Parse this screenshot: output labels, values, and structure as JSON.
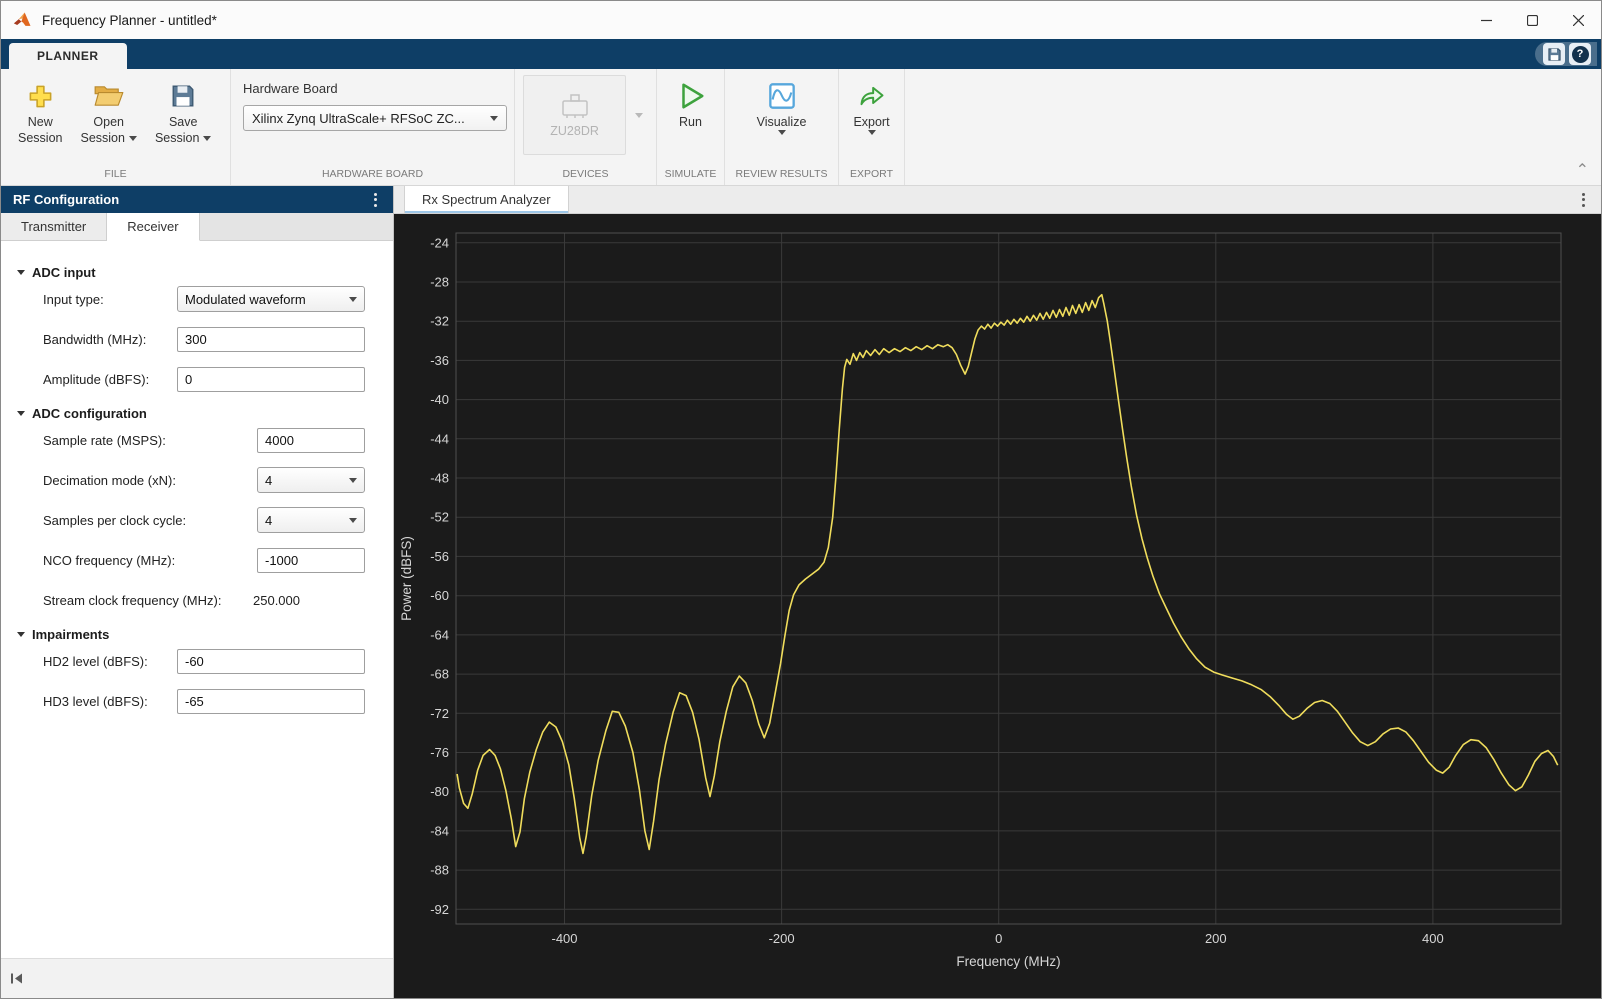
{
  "window": {
    "title": "Frequency Planner - untitled*"
  },
  "icons": {
    "kebab": "⋮",
    "help": "?",
    "collapse_chevron": "⌃"
  },
  "ribbon": {
    "tab_label": "PLANNER",
    "file": {
      "new_line1": "New",
      "new_line2": "Session",
      "open_line1": "Open",
      "open_line2": "Session",
      "save_line1": "Save",
      "save_line2": "Session",
      "section_label": "FILE"
    },
    "hardware_board": {
      "field_label": "Hardware Board",
      "selected": "Xilinx Zynq UltraScale+ RFSoC ZC...",
      "section_label": "HARDWARE BOARD"
    },
    "devices": {
      "device_name": "ZU28DR",
      "section_label": "DEVICES"
    },
    "simulate": {
      "run_label": "Run",
      "section_label": "SIMULATE"
    },
    "review": {
      "visualize_label": "Visualize",
      "section_label": "REVIEW RESULTS"
    },
    "export": {
      "export_label": "Export",
      "section_label": "EXPORT"
    }
  },
  "left_panel": {
    "header": "RF Configuration",
    "tabs": [
      {
        "label": "Transmitter"
      },
      {
        "label": "Receiver"
      }
    ],
    "sections": {
      "adc_input": "ADC input",
      "adc_config": "ADC configuration",
      "impairments": "Impairments"
    },
    "fields": {
      "input_type": {
        "label": "Input type:",
        "value": "Modulated waveform"
      },
      "bandwidth": {
        "label": "Bandwidth (MHz):",
        "value": "300"
      },
      "amplitude": {
        "label": "Amplitude (dBFS):",
        "value": "0"
      },
      "sample_rate": {
        "label": "Sample rate (MSPS):",
        "value": "4000"
      },
      "decimation": {
        "label": "Decimation mode (xN):",
        "value": "4"
      },
      "samples_per_clock": {
        "label": "Samples per clock cycle:",
        "value": "4"
      },
      "nco": {
        "label": "NCO frequency (MHz):",
        "value": "-1000"
      },
      "stream_clock": {
        "label": "Stream clock frequency (MHz):",
        "value": "250.000"
      },
      "hd2": {
        "label": "HD2 level (dBFS):",
        "value": "-60"
      },
      "hd3": {
        "label": "HD3 level (dBFS):",
        "value": "-65"
      }
    }
  },
  "right_panel": {
    "tab_label": "Rx Spectrum Analyzer"
  },
  "chart_data": {
    "type": "line",
    "title": "",
    "xlabel": "Frequency (MHz)",
    "ylabel": "Power (dBFS)",
    "xlim": [
      -500,
      518
    ],
    "ylim": [
      -93.5,
      -23
    ],
    "xticks": [
      -400,
      -200,
      0,
      200,
      400
    ],
    "yticks": [
      -24,
      -28,
      -32,
      -36,
      -40,
      -44,
      -48,
      -52,
      -56,
      -60,
      -64,
      -68,
      -72,
      -76,
      -80,
      -84,
      -88,
      -92
    ],
    "grid": true,
    "legend": "none",
    "background": "#1b1b1b",
    "grid_color": "#3a3a3a",
    "box_color": "#4f4f4f",
    "text_color": "#d6d6d6",
    "trace_color": "#f0dd5c",
    "series": [
      {
        "name": "Rx spectrum",
        "points": [
          [
            -499,
            -78.2
          ],
          [
            -497,
            -79.6
          ],
          [
            -493,
            -81.2
          ],
          [
            -489,
            -81.7
          ],
          [
            -485,
            -80.2
          ],
          [
            -480,
            -77.8
          ],
          [
            -475,
            -76.3
          ],
          [
            -469,
            -75.7
          ],
          [
            -464,
            -76.3
          ],
          [
            -459,
            -77.7
          ],
          [
            -454,
            -79.9
          ],
          [
            -449,
            -82.8
          ],
          [
            -445,
            -85.6
          ],
          [
            -441,
            -84.1
          ],
          [
            -437,
            -80.7
          ],
          [
            -432,
            -78.0
          ],
          [
            -426,
            -75.7
          ],
          [
            -420,
            -73.9
          ],
          [
            -414,
            -72.9
          ],
          [
            -408,
            -73.4
          ],
          [
            -402,
            -74.9
          ],
          [
            -396,
            -77.3
          ],
          [
            -391,
            -80.7
          ],
          [
            -386,
            -84.7
          ],
          [
            -383,
            -86.3
          ],
          [
            -380,
            -84.5
          ],
          [
            -375,
            -80.4
          ],
          [
            -369,
            -76.8
          ],
          [
            -362,
            -73.8
          ],
          [
            -356,
            -71.8
          ],
          [
            -350,
            -71.9
          ],
          [
            -344,
            -73.3
          ],
          [
            -337,
            -76.0
          ],
          [
            -331,
            -79.8
          ],
          [
            -326,
            -84.0
          ],
          [
            -322,
            -85.9
          ],
          [
            -318,
            -83.0
          ],
          [
            -313,
            -78.8
          ],
          [
            -307,
            -75.2
          ],
          [
            -300,
            -71.9
          ],
          [
            -294,
            -69.9
          ],
          [
            -288,
            -70.2
          ],
          [
            -282,
            -71.9
          ],
          [
            -276,
            -74.7
          ],
          [
            -270,
            -78.6
          ],
          [
            -266,
            -80.5
          ],
          [
            -262,
            -78.4
          ],
          [
            -257,
            -74.9
          ],
          [
            -251,
            -71.8
          ],
          [
            -245,
            -69.3
          ],
          [
            -239,
            -68.2
          ],
          [
            -233,
            -68.9
          ],
          [
            -227,
            -70.7
          ],
          [
            -221,
            -73.1
          ],
          [
            -216,
            -74.5
          ],
          [
            -211,
            -73.0
          ],
          [
            -206,
            -70.0
          ],
          [
            -201,
            -66.9
          ],
          [
            -197,
            -64.1
          ],
          [
            -193,
            -61.5
          ],
          [
            -189,
            -59.9
          ],
          [
            -184,
            -58.9
          ],
          [
            -178,
            -58.3
          ],
          [
            -172,
            -57.8
          ],
          [
            -166,
            -57.3
          ],
          [
            -161,
            -56.6
          ],
          [
            -157,
            -55.1
          ],
          [
            -153,
            -52.0
          ],
          [
            -150,
            -47.9
          ],
          [
            -147,
            -43.1
          ],
          [
            -144,
            -38.9
          ],
          [
            -142,
            -36.7
          ],
          [
            -140,
            -35.9
          ],
          [
            -137,
            -36.4
          ],
          [
            -134,
            -35.3
          ],
          [
            -131,
            -36.0
          ],
          [
            -128,
            -35.2
          ],
          [
            -125,
            -35.7
          ],
          [
            -122,
            -35.0
          ],
          [
            -118,
            -35.5
          ],
          [
            -114,
            -34.9
          ],
          [
            -110,
            -35.4
          ],
          [
            -106,
            -34.8
          ],
          [
            -101,
            -35.2
          ],
          [
            -96,
            -34.8
          ],
          [
            -91,
            -35.1
          ],
          [
            -86,
            -34.7
          ],
          [
            -81,
            -35.0
          ],
          [
            -76,
            -34.6
          ],
          [
            -71,
            -34.9
          ],
          [
            -66,
            -34.5
          ],
          [
            -61,
            -34.8
          ],
          [
            -56,
            -34.4
          ],
          [
            -51,
            -34.6
          ],
          [
            -47,
            -34.4
          ],
          [
            -43,
            -34.7
          ],
          [
            -39,
            -35.4
          ],
          [
            -35,
            -36.5
          ],
          [
            -31,
            -37.4
          ],
          [
            -28,
            -36.6
          ],
          [
            -25,
            -35.2
          ],
          [
            -22,
            -33.8
          ],
          [
            -19,
            -32.9
          ],
          [
            -16,
            -32.5
          ],
          [
            -13,
            -32.8
          ],
          [
            -10,
            -32.3
          ],
          [
            -7,
            -32.7
          ],
          [
            -4,
            -32.2
          ],
          [
            -1,
            -32.5
          ],
          [
            2,
            -32.1
          ],
          [
            5,
            -32.4
          ],
          [
            8,
            -31.9
          ],
          [
            11,
            -32.3
          ],
          [
            14,
            -31.8
          ],
          [
            17,
            -32.2
          ],
          [
            20,
            -31.7
          ],
          [
            23,
            -32.1
          ],
          [
            26,
            -31.5
          ],
          [
            29,
            -32.0
          ],
          [
            32,
            -31.4
          ],
          [
            35,
            -31.9
          ],
          [
            38,
            -31.2
          ],
          [
            41,
            -31.8
          ],
          [
            44,
            -31.1
          ],
          [
            47,
            -31.7
          ],
          [
            50,
            -30.9
          ],
          [
            53,
            -31.6
          ],
          [
            56,
            -30.8
          ],
          [
            59,
            -31.5
          ],
          [
            62,
            -30.6
          ],
          [
            65,
            -31.4
          ],
          [
            68,
            -30.4
          ],
          [
            71,
            -31.2
          ],
          [
            74,
            -30.3
          ],
          [
            77,
            -31.1
          ],
          [
            80,
            -30.1
          ],
          [
            83,
            -30.9
          ],
          [
            86,
            -29.9
          ],
          [
            89,
            -30.6
          ],
          [
            92,
            -29.6
          ],
          [
            95,
            -29.3
          ],
          [
            97,
            -30.3
          ],
          [
            100,
            -32.0
          ],
          [
            103,
            -34.2
          ],
          [
            106,
            -36.6
          ],
          [
            110,
            -39.8
          ],
          [
            114,
            -43.0
          ],
          [
            118,
            -46.0
          ],
          [
            122,
            -48.8
          ],
          [
            127,
            -51.8
          ],
          [
            132,
            -54.2
          ],
          [
            137,
            -56.2
          ],
          [
            142,
            -58.0
          ],
          [
            148,
            -59.8
          ],
          [
            154,
            -61.2
          ],
          [
            161,
            -62.8
          ],
          [
            168,
            -64.2
          ],
          [
            175,
            -65.4
          ],
          [
            182,
            -66.4
          ],
          [
            190,
            -67.3
          ],
          [
            198,
            -67.8
          ],
          [
            206,
            -68.1
          ],
          [
            215,
            -68.4
          ],
          [
            224,
            -68.7
          ],
          [
            233,
            -69.1
          ],
          [
            242,
            -69.6
          ],
          [
            250,
            -70.3
          ],
          [
            258,
            -71.2
          ],
          [
            265,
            -72.1
          ],
          [
            271,
            -72.6
          ],
          [
            277,
            -72.3
          ],
          [
            284,
            -71.5
          ],
          [
            291,
            -70.9
          ],
          [
            298,
            -70.7
          ],
          [
            305,
            -71.0
          ],
          [
            312,
            -71.8
          ],
          [
            319,
            -72.9
          ],
          [
            326,
            -74.0
          ],
          [
            333,
            -74.9
          ],
          [
            340,
            -75.3
          ],
          [
            347,
            -74.9
          ],
          [
            354,
            -74.1
          ],
          [
            361,
            -73.6
          ],
          [
            368,
            -73.5
          ],
          [
            375,
            -73.9
          ],
          [
            382,
            -74.8
          ],
          [
            389,
            -75.9
          ],
          [
            396,
            -77.0
          ],
          [
            403,
            -77.8
          ],
          [
            409,
            -78.1
          ],
          [
            415,
            -77.5
          ],
          [
            421,
            -76.3
          ],
          [
            428,
            -75.2
          ],
          [
            435,
            -74.7
          ],
          [
            442,
            -74.8
          ],
          [
            449,
            -75.5
          ],
          [
            456,
            -76.7
          ],
          [
            463,
            -78.1
          ],
          [
            470,
            -79.3
          ],
          [
            476,
            -79.9
          ],
          [
            482,
            -79.5
          ],
          [
            488,
            -78.3
          ],
          [
            494,
            -76.9
          ],
          [
            500,
            -76.1
          ],
          [
            506,
            -75.8
          ],
          [
            511,
            -76.4
          ],
          [
            515,
            -77.3
          ]
        ]
      }
    ]
  }
}
